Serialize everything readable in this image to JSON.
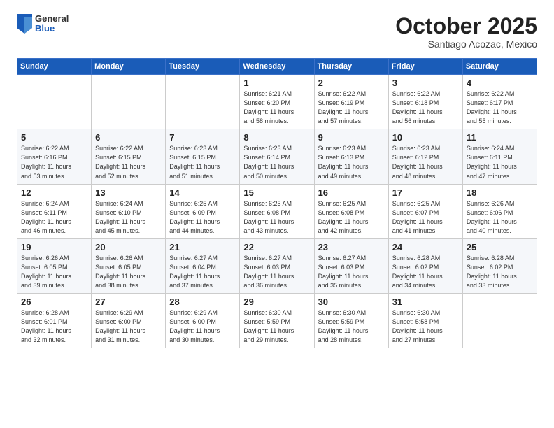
{
  "logo": {
    "general": "General",
    "blue": "Blue"
  },
  "header": {
    "month": "October 2025",
    "location": "Santiago Acozac, Mexico"
  },
  "weekdays": [
    "Sunday",
    "Monday",
    "Tuesday",
    "Wednesday",
    "Thursday",
    "Friday",
    "Saturday"
  ],
  "weeks": [
    [
      {
        "day": "",
        "info": ""
      },
      {
        "day": "",
        "info": ""
      },
      {
        "day": "",
        "info": ""
      },
      {
        "day": "1",
        "info": "Sunrise: 6:21 AM\nSunset: 6:20 PM\nDaylight: 11 hours\nand 58 minutes."
      },
      {
        "day": "2",
        "info": "Sunrise: 6:22 AM\nSunset: 6:19 PM\nDaylight: 11 hours\nand 57 minutes."
      },
      {
        "day": "3",
        "info": "Sunrise: 6:22 AM\nSunset: 6:18 PM\nDaylight: 11 hours\nand 56 minutes."
      },
      {
        "day": "4",
        "info": "Sunrise: 6:22 AM\nSunset: 6:17 PM\nDaylight: 11 hours\nand 55 minutes."
      }
    ],
    [
      {
        "day": "5",
        "info": "Sunrise: 6:22 AM\nSunset: 6:16 PM\nDaylight: 11 hours\nand 53 minutes."
      },
      {
        "day": "6",
        "info": "Sunrise: 6:22 AM\nSunset: 6:15 PM\nDaylight: 11 hours\nand 52 minutes."
      },
      {
        "day": "7",
        "info": "Sunrise: 6:23 AM\nSunset: 6:15 PM\nDaylight: 11 hours\nand 51 minutes."
      },
      {
        "day": "8",
        "info": "Sunrise: 6:23 AM\nSunset: 6:14 PM\nDaylight: 11 hours\nand 50 minutes."
      },
      {
        "day": "9",
        "info": "Sunrise: 6:23 AM\nSunset: 6:13 PM\nDaylight: 11 hours\nand 49 minutes."
      },
      {
        "day": "10",
        "info": "Sunrise: 6:23 AM\nSunset: 6:12 PM\nDaylight: 11 hours\nand 48 minutes."
      },
      {
        "day": "11",
        "info": "Sunrise: 6:24 AM\nSunset: 6:11 PM\nDaylight: 11 hours\nand 47 minutes."
      }
    ],
    [
      {
        "day": "12",
        "info": "Sunrise: 6:24 AM\nSunset: 6:11 PM\nDaylight: 11 hours\nand 46 minutes."
      },
      {
        "day": "13",
        "info": "Sunrise: 6:24 AM\nSunset: 6:10 PM\nDaylight: 11 hours\nand 45 minutes."
      },
      {
        "day": "14",
        "info": "Sunrise: 6:25 AM\nSunset: 6:09 PM\nDaylight: 11 hours\nand 44 minutes."
      },
      {
        "day": "15",
        "info": "Sunrise: 6:25 AM\nSunset: 6:08 PM\nDaylight: 11 hours\nand 43 minutes."
      },
      {
        "day": "16",
        "info": "Sunrise: 6:25 AM\nSunset: 6:08 PM\nDaylight: 11 hours\nand 42 minutes."
      },
      {
        "day": "17",
        "info": "Sunrise: 6:25 AM\nSunset: 6:07 PM\nDaylight: 11 hours\nand 41 minutes."
      },
      {
        "day": "18",
        "info": "Sunrise: 6:26 AM\nSunset: 6:06 PM\nDaylight: 11 hours\nand 40 minutes."
      }
    ],
    [
      {
        "day": "19",
        "info": "Sunrise: 6:26 AM\nSunset: 6:05 PM\nDaylight: 11 hours\nand 39 minutes."
      },
      {
        "day": "20",
        "info": "Sunrise: 6:26 AM\nSunset: 6:05 PM\nDaylight: 11 hours\nand 38 minutes."
      },
      {
        "day": "21",
        "info": "Sunrise: 6:27 AM\nSunset: 6:04 PM\nDaylight: 11 hours\nand 37 minutes."
      },
      {
        "day": "22",
        "info": "Sunrise: 6:27 AM\nSunset: 6:03 PM\nDaylight: 11 hours\nand 36 minutes."
      },
      {
        "day": "23",
        "info": "Sunrise: 6:27 AM\nSunset: 6:03 PM\nDaylight: 11 hours\nand 35 minutes."
      },
      {
        "day": "24",
        "info": "Sunrise: 6:28 AM\nSunset: 6:02 PM\nDaylight: 11 hours\nand 34 minutes."
      },
      {
        "day": "25",
        "info": "Sunrise: 6:28 AM\nSunset: 6:02 PM\nDaylight: 11 hours\nand 33 minutes."
      }
    ],
    [
      {
        "day": "26",
        "info": "Sunrise: 6:28 AM\nSunset: 6:01 PM\nDaylight: 11 hours\nand 32 minutes."
      },
      {
        "day": "27",
        "info": "Sunrise: 6:29 AM\nSunset: 6:00 PM\nDaylight: 11 hours\nand 31 minutes."
      },
      {
        "day": "28",
        "info": "Sunrise: 6:29 AM\nSunset: 6:00 PM\nDaylight: 11 hours\nand 30 minutes."
      },
      {
        "day": "29",
        "info": "Sunrise: 6:30 AM\nSunset: 5:59 PM\nDaylight: 11 hours\nand 29 minutes."
      },
      {
        "day": "30",
        "info": "Sunrise: 6:30 AM\nSunset: 5:59 PM\nDaylight: 11 hours\nand 28 minutes."
      },
      {
        "day": "31",
        "info": "Sunrise: 6:30 AM\nSunset: 5:58 PM\nDaylight: 11 hours\nand 27 minutes."
      },
      {
        "day": "",
        "info": ""
      }
    ]
  ]
}
